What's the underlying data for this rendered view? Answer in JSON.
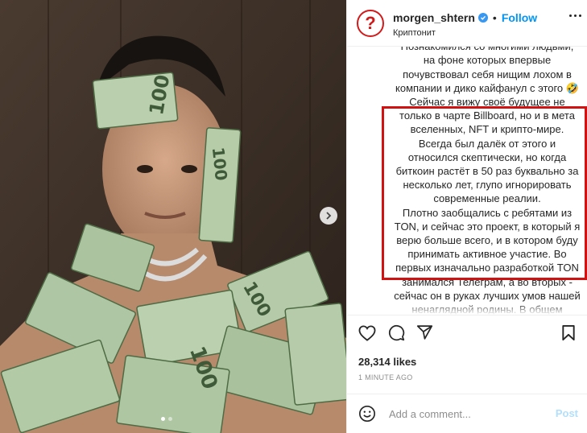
{
  "post": {
    "username": "morgen_shtern",
    "separator": "•",
    "follow_label": "Follow",
    "location": "Криптонит",
    "caption_paragraphs": [
      "очередную цепь, тачку или дом)\nПознакомился со многими людьми, на фоне которых впервые почувствовал себя нищим лохом в компании и дико кайфанул с этого 🤣",
      "Сейчас я вижу своё будущее не только в чарте Billboard, но и в мета вселенных, NFT и крипто-мире. Всегда был далёк от этого и относился скептически, но когда биткоин растёт в 50 раз буквально за несколько лет, глупо игнорировать современные реалии.",
      "Плотно заобщались с ребятами из TON, и сейчас это проект, в который я верю больше всего, и в котором буду принимать активное участие. Во первых изначально разработкой TON занимался Телеграм, а во вторых - сейчас он в руках лучших умов нашей ненаглядной родины. В общем"
    ],
    "likes": "28,314 likes",
    "time": "1 MINUTE AGO",
    "comment_placeholder": "Add a comment...",
    "post_label": "Post",
    "carousel": {
      "slide_count": 2,
      "active_index": 0
    }
  },
  "icons": {
    "avatar": "question-mark-logo",
    "verified": "verified-badge-icon",
    "more": "more-options-icon",
    "like": "heart-icon",
    "comment": "comment-icon",
    "share": "send-icon",
    "save": "bookmark-icon",
    "emoji": "emoji-icon",
    "next": "chevron-right-icon"
  },
  "colors": {
    "link_blue": "#0095f6",
    "highlight_red": "#d01212",
    "avatar_red": "#d11b1b",
    "muted_text": "#8e8e8e"
  }
}
